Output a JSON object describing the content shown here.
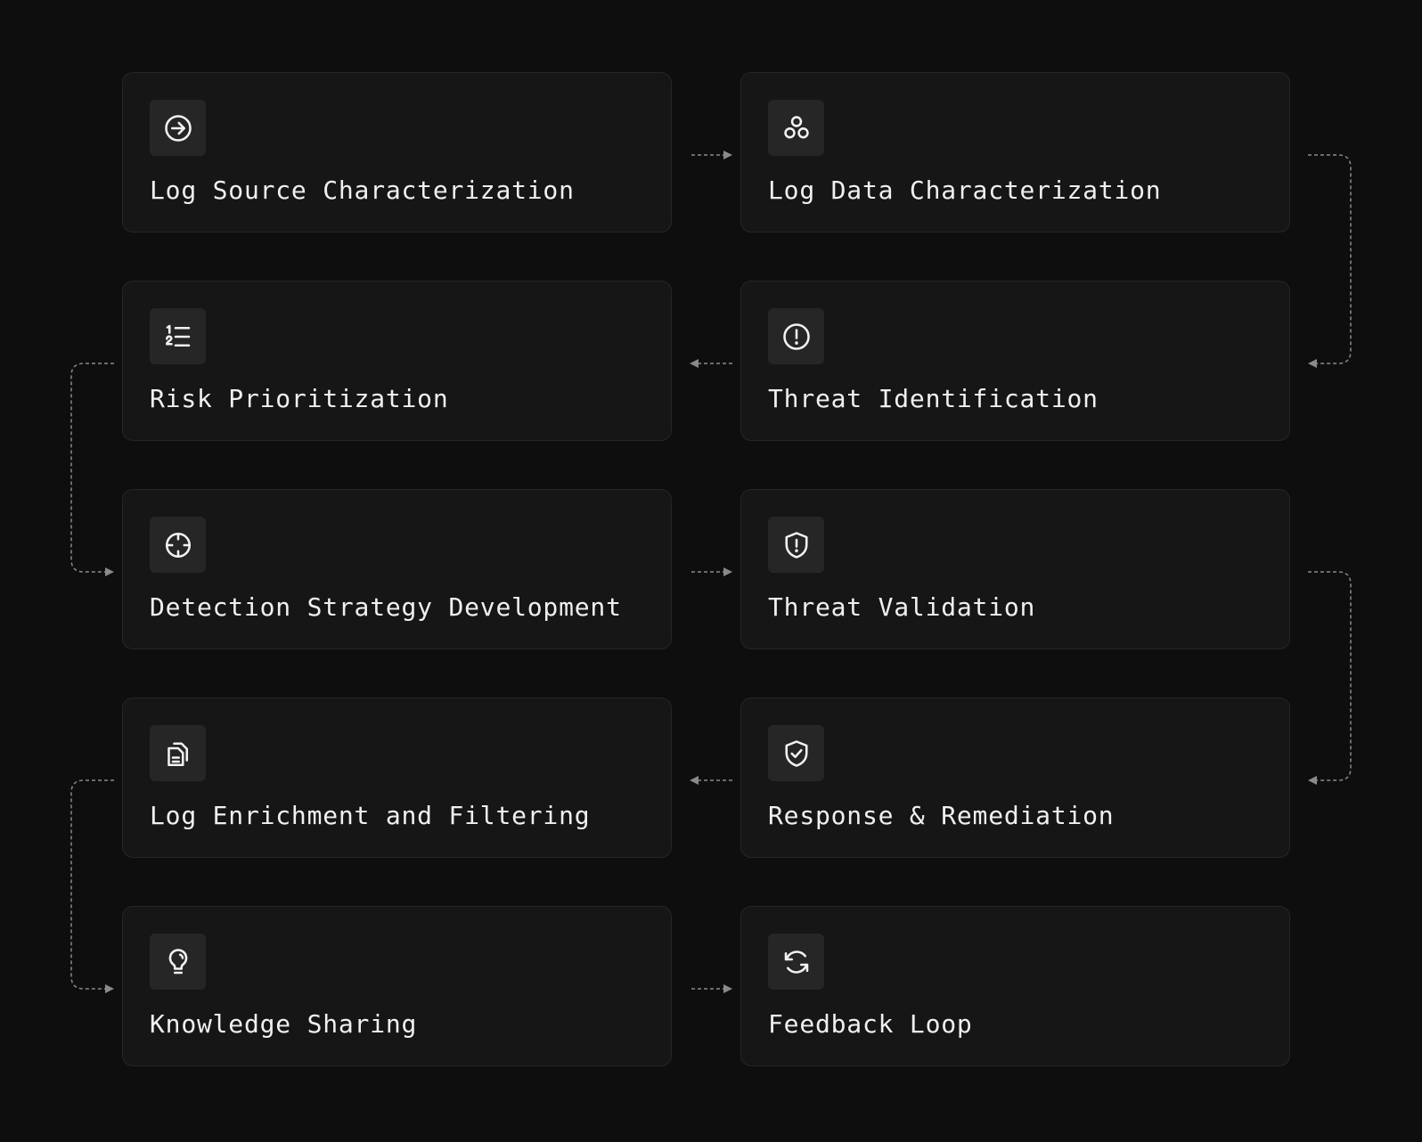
{
  "steps": [
    {
      "label": "Log Source Characterization",
      "icon": "arrow-circle-right-icon"
    },
    {
      "label": "Log Data Characterization",
      "icon": "three-circles-icon"
    },
    {
      "label": "Risk Prioritization",
      "icon": "numbered-list-icon"
    },
    {
      "label": "Threat Identification",
      "icon": "alert-circle-icon"
    },
    {
      "label": "Detection Strategy Development",
      "icon": "crosshair-icon"
    },
    {
      "label": "Threat Validation",
      "icon": "shield-alert-icon"
    },
    {
      "label": "Log Enrichment and Filtering",
      "icon": "documents-icon"
    },
    {
      "label": "Response & Remediation",
      "icon": "shield-check-icon"
    },
    {
      "label": "Knowledge Sharing",
      "icon": "lightbulb-icon"
    },
    {
      "label": "Feedback Loop",
      "icon": "refresh-icon"
    }
  ],
  "colors": {
    "background": "#0e0e0e",
    "card": "#161616",
    "card_border": "#262626",
    "icon_bg": "#262626",
    "text": "#f0f0f0",
    "connector": "#8a8a8a"
  }
}
